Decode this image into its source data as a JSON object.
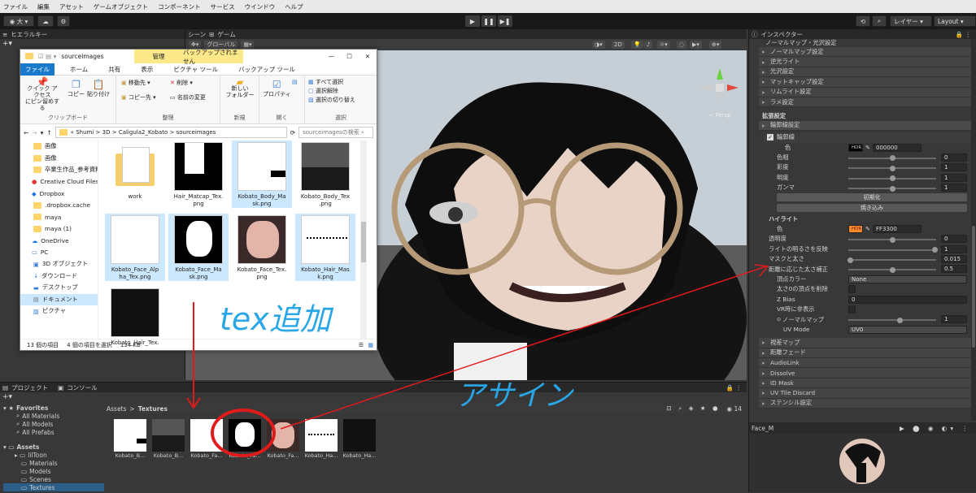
{
  "menubar": {
    "items": [
      "ファイル",
      "編集",
      "アセット",
      "ゲームオブジェクト",
      "コンポーネント",
      "サービス",
      "ウインドウ",
      "ヘルプ"
    ]
  },
  "toolbar": {
    "account": "大 ▾",
    "layers": "レイヤー",
    "layout": "Layout"
  },
  "hierarchy": {
    "tab": "ヒエラルキー"
  },
  "scene": {
    "tabs": [
      "シーン",
      "ゲーム"
    ],
    "shading": "グローバル",
    "mode_2d": "2D",
    "persp": "< Persp"
  },
  "explorer": {
    "title": "sourceimages",
    "ribbon_context_tab": "管理",
    "ribbon_backup_tab": "バックアップされません",
    "tabs": [
      "ファイル",
      "ホーム",
      "共有",
      "表示",
      "ピクチャ ツール",
      "バックアップ ツール"
    ],
    "ribbon": {
      "pin": "クイック アクセス\nにピン留めする",
      "copy": "コピー",
      "paste": "貼り付け",
      "move": "移動先 ▾",
      "delete": "削除 ▾",
      "copy_to": "コピー先 ▾",
      "rename": "名前の変更",
      "new_folder": "新しい\nフォルダー",
      "properties": "プロパティ",
      "select_all": "すべて選択",
      "select_none": "選択解除",
      "invert": "選択の切り替え",
      "groups": [
        "クリップボード",
        "整理",
        "新規",
        "開く",
        "選択"
      ]
    },
    "address": [
      "«",
      "Shumi",
      ">",
      "3D",
      ">",
      "Caligula2_Kobato",
      ">",
      "sourceimages"
    ],
    "search_placeholder": "sourceimagesの検索",
    "nav": [
      "画像",
      "画像",
      "卒業生作品_参考資料",
      "Creative Cloud Files",
      "Dropbox",
      ".dropbox.cache",
      "maya",
      "maya (1)",
      "OneDrive",
      "PC",
      "3D オブジェクト",
      "ダウンロード",
      "デスクトップ",
      "ドキュメント",
      "ピクチャ"
    ],
    "files": [
      {
        "name": "work"
      },
      {
        "name": "Hair_Matcap_Tex.\npng"
      },
      {
        "name": "Kobato_Body_Ma\nsk.png"
      },
      {
        "name": "Kobato_Body_Tex\n.png"
      },
      {
        "name": "Kobato_Face_Alp\nha_Tex.png"
      },
      {
        "name": "Kobato_Face_Ma\nsk.png"
      },
      {
        "name": "Kobato_Face_Tex.\npng"
      },
      {
        "name": "Kobato_Hair_Mas\nk.png"
      },
      {
        "name": "Kobato_Hair_Tex."
      }
    ],
    "status": {
      "count": "13 個の項目",
      "selected": "4 個の項目を選択",
      "size": "134 KB"
    }
  },
  "inspector": {
    "tab": "インスペクター",
    "partial_header": "ノーマルマップ・光沢設定",
    "folds_top": [
      "ノーマルマップ設定",
      "逆光ライト",
      "光沢設定",
      "マットキャップ設定",
      "リムライト設定",
      "ラメ設定"
    ],
    "section_ext": "拡張設定",
    "outline_fold": "輪郭線設定",
    "outline_toggle": "輪郭線",
    "color_label": "色",
    "hdr": "HDR",
    "color_hex": "000000",
    "rows1": [
      {
        "label": "色相",
        "value": "0"
      },
      {
        "label": "彩度",
        "value": "1"
      },
      {
        "label": "明度",
        "value": "1"
      },
      {
        "label": "ガンマ",
        "value": "1"
      }
    ],
    "btn_reset": "初期化",
    "btn_bake": "焼き込み",
    "highlight": "ハイライト",
    "hl_color_label": "色",
    "hl_color_hex": "FF3300",
    "hl_color": "#ff8a2a",
    "rows2": [
      {
        "label": "透明度",
        "value": "0"
      },
      {
        "label": "ライトの明るさを反映",
        "value": "1"
      },
      {
        "label": "マスクと太さ",
        "value": "0.015"
      },
      {
        "label": "距離に応じた太さ補正",
        "value": "0.5"
      }
    ],
    "vertex_color_label": "頂点カラー",
    "vertex_color_value": "None",
    "cull_label": "太さ0の頂点を削除",
    "zbias_label": "Z Bias",
    "zbias_value": "0",
    "vr_label": "VR時に非表示",
    "normal_map_label": "ノーマルマップ",
    "normal_map_value": "1",
    "uv_mode_label": "UV Mode",
    "uv_mode_value": "UV0",
    "folds_bottom": [
      "視差マップ",
      "距離フェード",
      "AudioLink",
      "Dissolve",
      "ID Mask",
      "UV Tile Discard",
      "ステンシル設定"
    ],
    "preview_name": "Face_M"
  },
  "project": {
    "tabs": [
      "プロジェクト",
      "コンソール"
    ],
    "favorites": "Favorites",
    "fav_items": [
      "All Materials",
      "All Models",
      "All Prefabs"
    ],
    "assets": "Assets",
    "asset_folders": [
      "lilToon",
      "Materials",
      "Models",
      "Scenes",
      "Textures"
    ],
    "breadcrumb": [
      "Assets",
      ">",
      "Textures"
    ],
    "count": "14",
    "thumbs": [
      "Kobato_B...",
      "Kobato_B...",
      "Kobato_Fa...",
      "Kobato_Fa...",
      "Kobato_Fa...",
      "Kobato_Ha...",
      "Kobato_Ha..."
    ]
  },
  "annotations": {
    "tex_add": "tex追加",
    "assign": "アサイン",
    "arrow_color": "#e01b1b",
    "text_color": "#29a6e6"
  }
}
